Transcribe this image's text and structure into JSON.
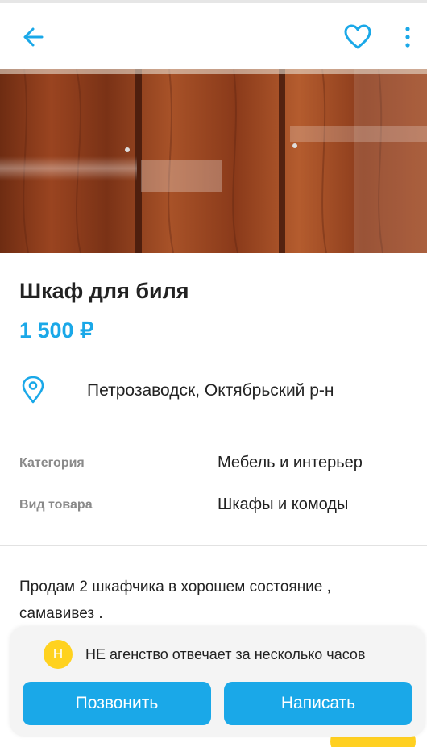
{
  "header": {
    "back_icon": "arrow-left-icon",
    "favorite_icon": "heart-outline-icon",
    "more_icon": "more-vertical-icon",
    "accent": "#1aa8e8"
  },
  "listing": {
    "photo": "wardrobe-photo",
    "title": "Шкаф для биля",
    "price": "1 500 ₽",
    "location_icon": "map-pin-icon",
    "location": "Петрозаводск, Октябрьский р-н"
  },
  "params": [
    {
      "label": "Категория",
      "value": "Мебель и интерьер"
    },
    {
      "label": "Вид товара",
      "value": "Шкафы и комоды"
    }
  ],
  "description": "Продам 2 шкафчика в хорошем состояние ,\nсамавивез  .",
  "contact": {
    "badge": "Н",
    "note": "НЕ агенство отвечает за несколько часов",
    "call_label": "Позвонить",
    "write_label": "Написать"
  }
}
